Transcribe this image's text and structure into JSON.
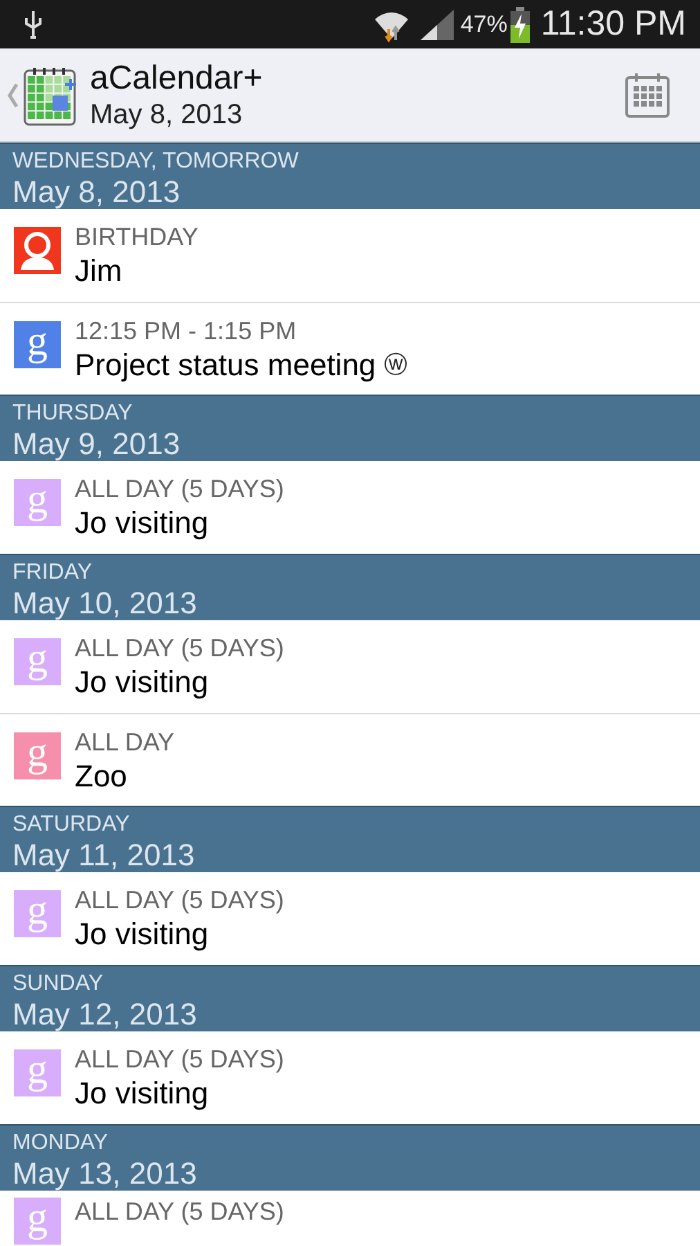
{
  "status_bar": {
    "battery": "47%",
    "time": "11:30 PM"
  },
  "header": {
    "title": "aCalendar+",
    "subtitle": "May 8, 2013"
  },
  "days": [
    {
      "weekday": "WEDNESDAY, TOMORROW",
      "date": "May 8, 2013",
      "events": [
        {
          "kind": "birthday",
          "color": "#f0361d",
          "label": "BIRTHDAY",
          "title": "Jim"
        },
        {
          "kind": "calendar",
          "color": "#5181e6",
          "icon_letter": "g",
          "label": "12:15 PM - 1:15 PM",
          "title": "Project status meeting",
          "badge": "ⓦ"
        }
      ]
    },
    {
      "weekday": "THURSDAY",
      "date": "May 9, 2013",
      "events": [
        {
          "kind": "calendar",
          "color": "#d8aefc",
          "icon_letter": "g",
          "label": "ALL DAY (5 DAYS)",
          "title": "Jo visiting"
        }
      ]
    },
    {
      "weekday": "FRIDAY",
      "date": "May 10, 2013",
      "events": [
        {
          "kind": "calendar",
          "color": "#d8aefc",
          "icon_letter": "g",
          "label": "ALL DAY (5 DAYS)",
          "title": "Jo visiting"
        },
        {
          "kind": "calendar",
          "color": "#f58fab",
          "icon_letter": "g",
          "label": "ALL DAY",
          "title": "Zoo"
        }
      ]
    },
    {
      "weekday": "SATURDAY",
      "date": "May 11, 2013",
      "events": [
        {
          "kind": "calendar",
          "color": "#d8aefc",
          "icon_letter": "g",
          "label": "ALL DAY (5 DAYS)",
          "title": "Jo visiting"
        }
      ]
    },
    {
      "weekday": "SUNDAY",
      "date": "May 12, 2013",
      "events": [
        {
          "kind": "calendar",
          "color": "#d8aefc",
          "icon_letter": "g",
          "label": "ALL DAY (5 DAYS)",
          "title": "Jo visiting"
        }
      ]
    },
    {
      "weekday": "MONDAY",
      "date": "May 13, 2013",
      "events": [
        {
          "kind": "calendar",
          "color": "#d8aefc",
          "icon_letter": "g",
          "label": "ALL DAY (5 DAYS)"
        }
      ]
    }
  ]
}
